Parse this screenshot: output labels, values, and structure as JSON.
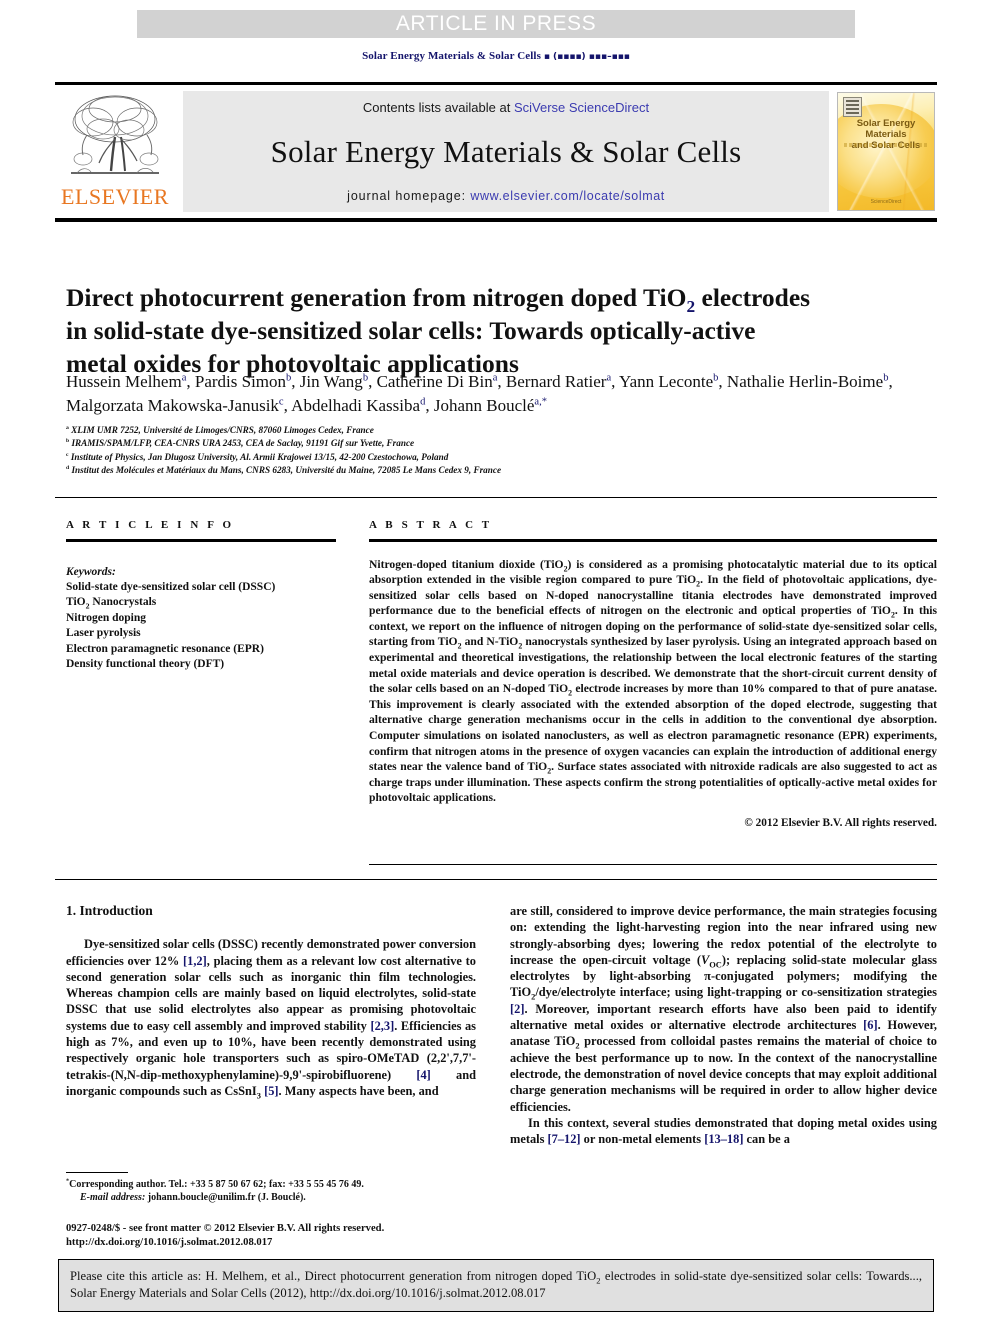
{
  "banner": {
    "text": "ARTICLE IN PRESS"
  },
  "running_head": {
    "journal": "Solar Energy Materials & Solar Cells",
    "volume_placeholder": "▪ (▪▪▪▪) ▪▪▪–▪▪▪"
  },
  "masthead": {
    "contents_prefix": "Contents lists available at ",
    "sciencedirect": "SciVerse ScienceDirect",
    "journal_title": "Solar Energy Materials & Solar Cells",
    "homepage_label": "journal homepage: ",
    "homepage_url": "www.elsevier.com/locate/solmat",
    "publisher": "ELSEVIER",
    "cover": {
      "title_line1": "Solar Energy Materials",
      "title_line2": "and Solar Cells",
      "footer": "ScienceDirect"
    }
  },
  "article": {
    "title_line1": "Direct photocurrent generation from nitrogen doped TiO",
    "title_sub1": "2",
    "title_line1_tail": " electrodes",
    "title_line2": "in solid-state dye-sensitized solar cells: Towards optically-active",
    "title_line3": "metal oxides for photovoltaic applications",
    "authors": [
      {
        "name": "Hussein Melhem",
        "mark": "a"
      },
      {
        "name": "Pardis Simon",
        "mark": "b"
      },
      {
        "name": "Jin Wang",
        "mark": "b"
      },
      {
        "name": "Catherine Di Bin",
        "mark": "a"
      },
      {
        "name": "Bernard Ratier",
        "mark": "a"
      },
      {
        "name": "Yann Leconte",
        "mark": "b"
      },
      {
        "name": "Nathalie Herlin-Boime",
        "mark": "b"
      },
      {
        "name": "Malgorzata Makowska-Janusik",
        "mark": "c"
      },
      {
        "name": "Abdelhadi Kassiba",
        "mark": "d"
      },
      {
        "name": "Johann Bouclé",
        "mark": "a,*"
      }
    ],
    "affiliations": [
      {
        "mark": "a",
        "text": "XLIM UMR 7252, Université de Limoges/CNRS, 87060 Limoges Cedex, France"
      },
      {
        "mark": "b",
        "text": "IRAMIS/SPAM/LFP, CEA-CNRS URA 2453, CEA de Saclay, 91191 Gif sur Yvette, France"
      },
      {
        "mark": "c",
        "text": "Institute of Physics, Jan Dlugosz University, Al. Armii Krajowei 13/15, 42-200 Czestochowa, Poland"
      },
      {
        "mark": "d",
        "text": "Institut des Molécules et Matériaux du Mans, CNRS 6283, Université du Maine, 72085 Le Mans Cedex 9, France"
      }
    ]
  },
  "article_info": {
    "heading": "A R T I C L E   I N F O",
    "keywords_label": "Keywords:",
    "keywords": [
      "Solid-state dye-sensitized solar cell (DSSC)",
      "TiO2 Nanocrystals",
      "Nitrogen doping",
      "Laser pyrolysis",
      "Electron paramagnetic resonance (EPR)",
      "Density functional theory (DFT)"
    ]
  },
  "abstract": {
    "heading": "A B S T R A C T",
    "text": "Nitrogen-doped titanium dioxide (TiO2) is considered as a promising photocatalytic material due to its optical absorption extended in the visible region compared to pure TiO2. In the field of photovoltaic applications, dye-sensitized solar cells based on N-doped nanocrystalline titania electrodes have demonstrated improved performance due to the beneficial effects of nitrogen on the electronic and optical properties of TiO2. In this context, we report on the influence of nitrogen doping on the performance of solid-state dye-sensitized solar cells, starting from TiO2 and N-TiO2 nanocrystals synthesized by laser pyrolysis. Using an integrated approach based on experimental and theoretical investigations, the relationship between the local electronic features of the starting metal oxide materials and device operation is described. We demonstrate that the short-circuit current density of the solar cells based on an N-doped TiO2 electrode increases by more than 10% compared to that of pure anatase. This improvement is clearly associated with the extended absorption of the doped electrode, suggesting that alternative charge generation mechanisms occur in the cells in addition to the conventional dye absorption. Computer simulations on isolated nanoclusters, as well as electron paramagnetic resonance (EPR) experiments, confirm that nitrogen atoms in the presence of oxygen vacancies can explain the introduction of additional energy states near the valence band of TiO2. Surface states associated with nitroxide radicals are also suggested to act as charge traps under illumination. These aspects confirm the strong potentialities of optically-active metal oxides for photovoltaic applications.",
    "copyright": "© 2012 Elsevier B.V. All rights reserved."
  },
  "introduction": {
    "heading": "1.  Introduction",
    "left_paragraph": "Dye-sensitized solar cells (DSSC) recently demonstrated power conversion efficiencies over 12% [1,2], placing them as a relevant low cost alternative to second generation solar cells such as inorganic thin film technologies. Whereas champion cells are mainly based on liquid electrolytes, solid-state DSSC that use solid electrolytes also appear as promising photovoltaic systems due to easy cell assembly and improved stability [2,3]. Efficiencies as high as 7%, and even up to 10%, have been recently demonstrated using respectively organic hole transporters such as spiro-OMeTAD (2,2',7,7'-tetrakis-(N,N-dip-methoxyphenylamine)-9,9'-spirobifluorene) [4] and inorganic compounds such as CsSnI3 [5]. Many aspects have been, and",
    "right_paragraph_1": "are still, considered to improve device performance, the main strategies focusing on: extending the light-harvesting region into the near infrared using new strongly-absorbing dyes; lowering the redox potential of the electrolyte to increase the open-circuit voltage (VOC); replacing solid-state molecular glass electrolytes by light-absorbing π-conjugated polymers; modifying the TiO2/dye/electrolyte interface; using light-trapping or co-sensitization strategies [2]. Moreover, important research efforts have also been paid to identify alternative metal oxides or alternative electrode architectures [6]. However, anatase TiO2 processed from colloidal pastes remains the material of choice to achieve the best performance up to now. In the context of the nanocrystalline electrode, the demonstration of novel device concepts that may exploit additional charge generation mechanisms will be required in order to allow higher device efficiencies.",
    "right_paragraph_2": "In this context, several studies demonstrated that doping metal oxides using metals [7–12] or non-metal elements [13–18] can be a"
  },
  "footnote": {
    "corresponding": "Corresponding author. Tel.: +33 5 87 50 67 62; fax: +33 5 55 45 76 49.",
    "email_label": "E-mail address:",
    "email": "johann.boucle@unilim.fr (J. Bouclé)."
  },
  "issn": {
    "line1": "0927-0248/$ - see front matter © 2012 Elsevier B.V. All rights reserved.",
    "line2": "http://dx.doi.org/10.1016/j.solmat.2012.08.017"
  },
  "cite_box": {
    "text": "Please cite this article as: H. Melhem, et al., Direct photocurrent generation from nitrogen doped TiO2 electrodes in solid-state dye-sensitized solar cells: Towards..., Solar Energy Materials and Solar Cells (2012), http://dx.doi.org/10.1016/j.solmat.2012.08.017"
  },
  "colors": {
    "banner_bg": "#d2d2d2",
    "link_blue": "#3b3bb0",
    "ref_blue": "#14146b",
    "elsevier_orange": "#e87722",
    "masthead_band": "#e8e8e8",
    "cite_box_bg": "#e0e0e0"
  }
}
